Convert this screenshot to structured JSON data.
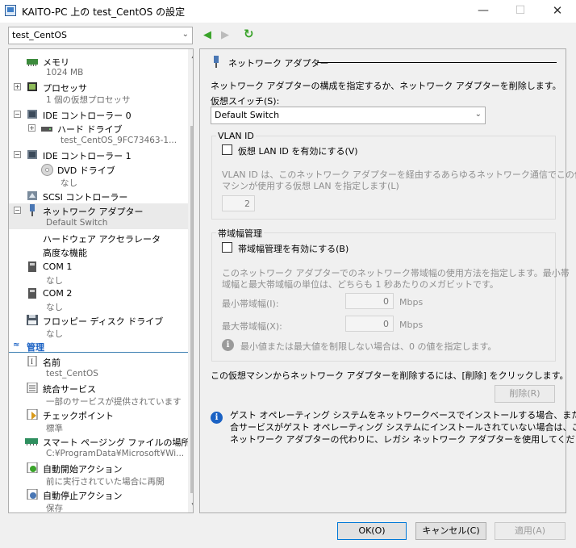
{
  "window": {
    "title": "KAITO-PC 上の test_CentOS の設定",
    "minimize": "—",
    "maximize": "☐",
    "close": "✕"
  },
  "vm_selector": {
    "value": "test_CentOS",
    "arrow": "⌄"
  },
  "nav": {
    "back": "◀",
    "forward": "▶",
    "refresh": "↻"
  },
  "sidebar": {
    "hardware": [
      {
        "label": "メモリ",
        "sub": "1024 MB",
        "icon": "memory-icon"
      },
      {
        "label": "プロセッサ",
        "sub": "1 個の仮想プロセッサ",
        "icon": "processor-icon",
        "expander": "+"
      },
      {
        "label": "IDE コントローラー 0",
        "icon": "ide-controller-icon",
        "expander": "−"
      },
      {
        "label": "ハード ドライブ",
        "sub": "test_CentOS_9FC73463-1...",
        "icon": "hard-drive-icon",
        "expander": "+"
      },
      {
        "label": "IDE コントローラー 1",
        "icon": "ide-controller-icon",
        "expander": "−"
      },
      {
        "label": "DVD ドライブ",
        "sub": "なし",
        "icon": "dvd-icon"
      },
      {
        "label": "SCSI コントローラー",
        "icon": "scsi-icon"
      },
      {
        "label": "ネットワーク アダプター",
        "sub": "Default Switch",
        "icon": "network-adapter-icon",
        "expander": "−"
      },
      {
        "label": "ハードウェア アクセラレータ"
      },
      {
        "label": "高度な機能"
      },
      {
        "label": "COM 1",
        "sub": "なし",
        "icon": "com-port-icon"
      },
      {
        "label": "COM 2",
        "sub": "なし",
        "icon": "com-port-icon"
      },
      {
        "label": "フロッピー ディスク ドライブ",
        "sub": "なし",
        "icon": "floppy-icon"
      }
    ],
    "management_header": "管理",
    "management_chevron": "≈",
    "management": [
      {
        "label": "名前",
        "sub": "test_CentOS",
        "icon": "name-icon"
      },
      {
        "label": "統合サービス",
        "sub": "一部のサービスが提供されています",
        "icon": "integration-services-icon"
      },
      {
        "label": "チェックポイント",
        "sub": "標準",
        "icon": "checkpoint-icon"
      },
      {
        "label": "スマート ページング ファイルの場所",
        "sub": "C:¥ProgramData¥Microsoft¥Wi...",
        "icon": "smart-paging-icon"
      },
      {
        "label": "自動開始アクション",
        "sub": "前に実行されていた場合に再開",
        "icon": "auto-start-icon"
      },
      {
        "label": "自動停止アクション",
        "sub": "保存",
        "icon": "auto-stop-icon"
      }
    ]
  },
  "main": {
    "section_title": "ネットワーク アダプター",
    "description": "ネットワーク アダプターの構成を指定するか、ネットワーク アダプターを削除します。",
    "switch_label": "仮想スイッチ(S):",
    "switch_value": "Default Switch",
    "vlan": {
      "title": "VLAN ID",
      "checkbox": "仮想 LAN ID を有効にする(V)",
      "desc_line1": "VLAN ID は、このネットワーク アダプターを経由するあらゆるネットワーク通信でこの仮想",
      "desc_line2": "マシンが使用する仮想 LAN を指定します(L)",
      "value": "2"
    },
    "bandwidth": {
      "title": "帯域幅管理",
      "checkbox": "帯域幅管理を有効にする(B)",
      "desc_line1": "このネットワーク アダプターでのネットワーク帯域幅の使用方法を指定します。最小帯",
      "desc_line2": "域幅と最大帯域幅の単位は、どちらも 1 秒あたりのメガビットです。",
      "min_label": "最小帯域幅(I):",
      "min_value": "0",
      "max_label": "最大帯域幅(X):",
      "max_value": "0",
      "unit": "Mbps",
      "note": "最小値または最大値を制限しない場合は、0 の値を指定します。"
    },
    "remove_text": "この仮想マシンからネットワーク アダプターを削除するには、[削除] をクリックします。",
    "remove_button": "削除(R)",
    "info_line1": "ゲスト オペレーティング システムをネットワークベースでインストールする場合、または統",
    "info_line2": "合サービスがゲスト オペレーティング システムにインストールされていない場合は、この",
    "info_line3": "ネットワーク アダプターの代わりに、レガシ ネットワーク アダプターを使用してください。",
    "info_glyph": "i"
  },
  "footer": {
    "ok": "OK(O)",
    "cancel": "キャンセル(C)",
    "apply": "適用(A)"
  },
  "colors": {
    "accent": "#1b62c4",
    "nav_green": "#3aa32a",
    "selection": "#eaeaea"
  }
}
